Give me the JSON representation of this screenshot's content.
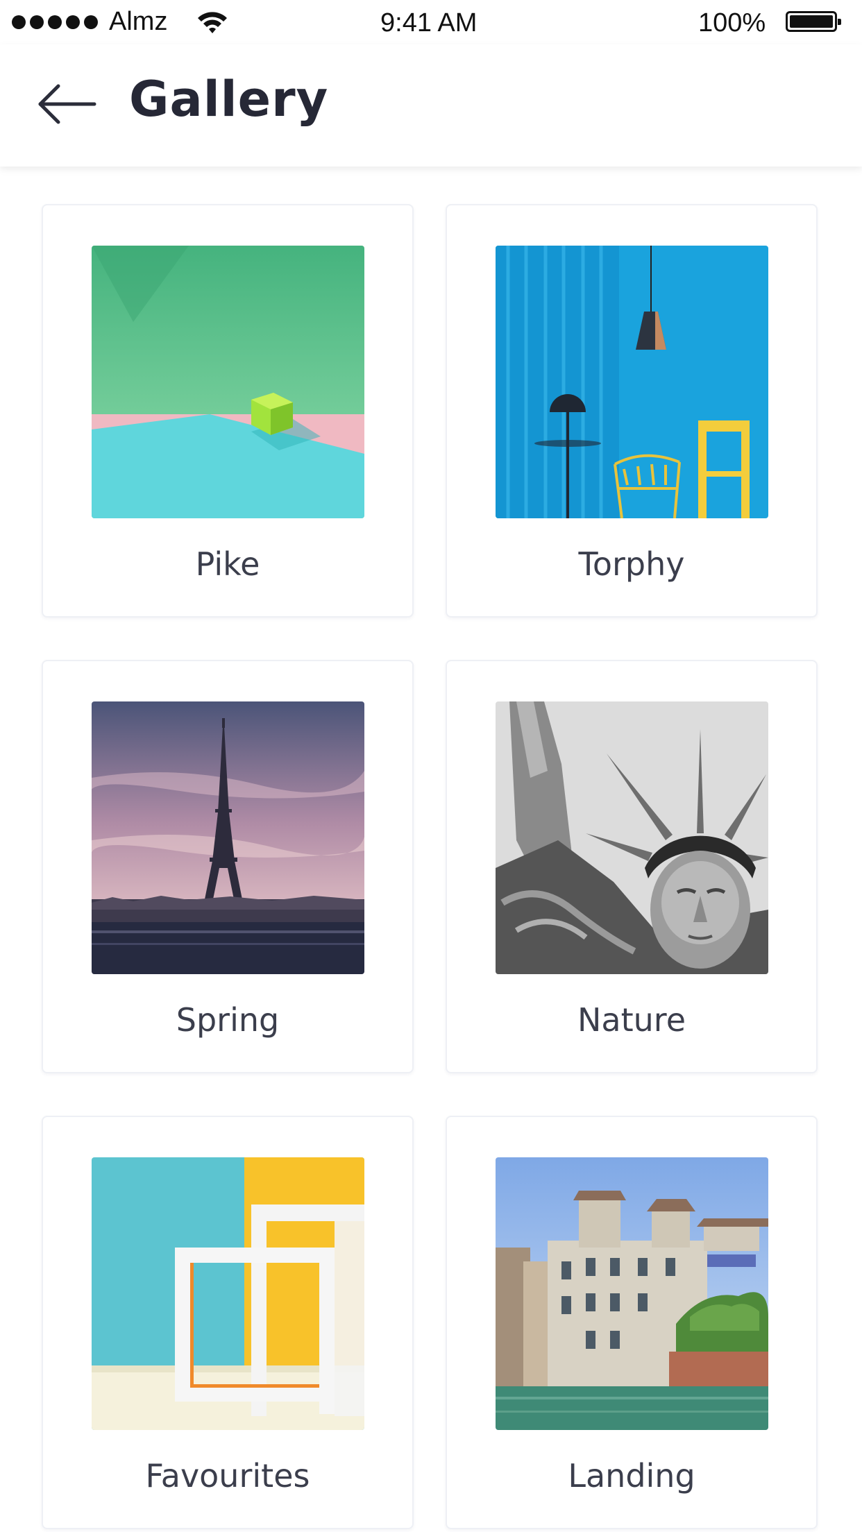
{
  "status_bar": {
    "carrier": "Almz",
    "time": "9:41 AM",
    "battery": "100%"
  },
  "header": {
    "title": "Gallery",
    "back_icon": "arrow-left-icon"
  },
  "gallery": {
    "items": [
      {
        "label": "Pike"
      },
      {
        "label": "Torphy"
      },
      {
        "label": "Spring"
      },
      {
        "label": "Nature"
      },
      {
        "label": "Favourites"
      },
      {
        "label": "Landing"
      }
    ]
  }
}
